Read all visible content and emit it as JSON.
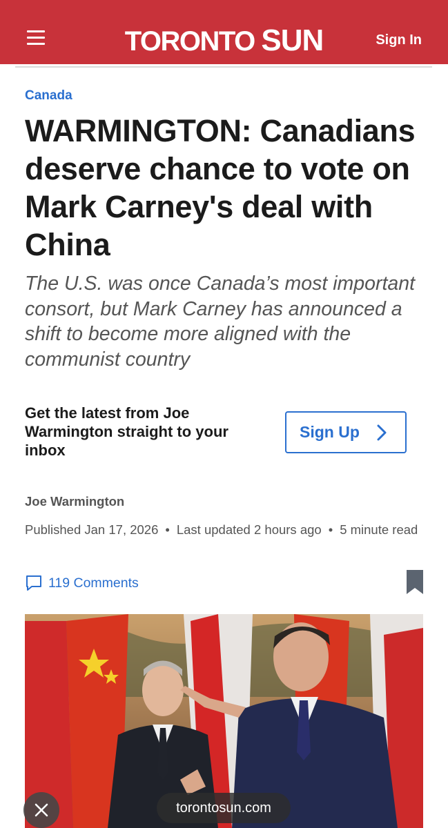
{
  "header": {
    "logo_word1": "TORONTO",
    "logo_word2": "SUN",
    "sign_in_label": "Sign In",
    "brand_color": "#c8323a"
  },
  "article": {
    "section": "Canada",
    "headline": "WARMINGTON: Canadians deserve chance to vote on Mark Carney's deal with China",
    "dek": "The U.S. was once Canada’s most important consort, but Mark Carney has announced a shift to become more aligned with the communist country",
    "author": "Joe Warmington",
    "published": "Published Jan 17, 2026",
    "updated": "Last updated 2 hours ago",
    "read_time": "5 minute read",
    "comments_label": "119 Comments"
  },
  "newsletter": {
    "text": "Get the latest from Joe Warmington straight to your inbox",
    "button_label": "Sign Up"
  },
  "browser": {
    "url": "torontosun.com"
  },
  "icons": {
    "menu": "hamburger-menu-icon",
    "chevron": "chevron-right-icon",
    "comment": "speech-bubble-icon",
    "bookmark": "bookmark-icon",
    "close": "close-x-icon"
  },
  "colors": {
    "link_blue": "#2a6fcf",
    "text_dark": "#1b1b1b",
    "text_grey": "#555555"
  }
}
